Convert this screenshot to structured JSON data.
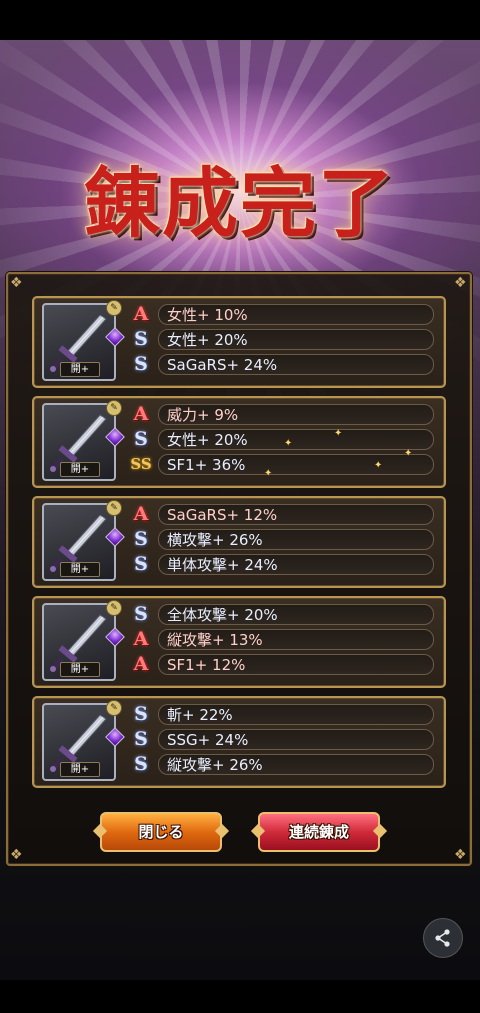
{
  "title": "錬成完了",
  "items": [
    {
      "level_label": "開+",
      "stats": [
        {
          "rank": "A",
          "text": "女性+ 10%"
        },
        {
          "rank": "S",
          "text": "女性+ 20%"
        },
        {
          "rank": "S",
          "text": "SaGaRS+ 24%"
        }
      ]
    },
    {
      "level_label": "開+",
      "stats": [
        {
          "rank": "A",
          "text": "威力+ 9%"
        },
        {
          "rank": "S",
          "text": "女性+ 20%"
        },
        {
          "rank": "SS",
          "text": "SF1+ 36%"
        }
      ]
    },
    {
      "level_label": "開+",
      "stats": [
        {
          "rank": "A",
          "text": "SaGaRS+ 12%"
        },
        {
          "rank": "S",
          "text": "横攻撃+ 26%"
        },
        {
          "rank": "S",
          "text": "単体攻撃+ 24%"
        }
      ]
    },
    {
      "level_label": "開+",
      "stats": [
        {
          "rank": "S",
          "text": "全体攻撃+ 20%"
        },
        {
          "rank": "A",
          "text": "縦攻撃+ 13%"
        },
        {
          "rank": "A",
          "text": "SF1+ 12%"
        }
      ]
    },
    {
      "level_label": "開+",
      "stats": [
        {
          "rank": "S",
          "text": "斬+ 22%"
        },
        {
          "rank": "S",
          "text": "SSG+ 24%"
        },
        {
          "rank": "S",
          "text": "縦攻撃+ 26%"
        }
      ]
    }
  ],
  "buttons": {
    "close_label": "閉じる",
    "continue_label": "連続錬成"
  },
  "icons": {
    "weapon": "sword-icon",
    "gem": "purple-gem-icon",
    "share": "share-icon"
  },
  "colors": {
    "rank_a": "#ff7a7a",
    "rank_s": "#d8e4ff",
    "frame_gold": "#b89650"
  }
}
